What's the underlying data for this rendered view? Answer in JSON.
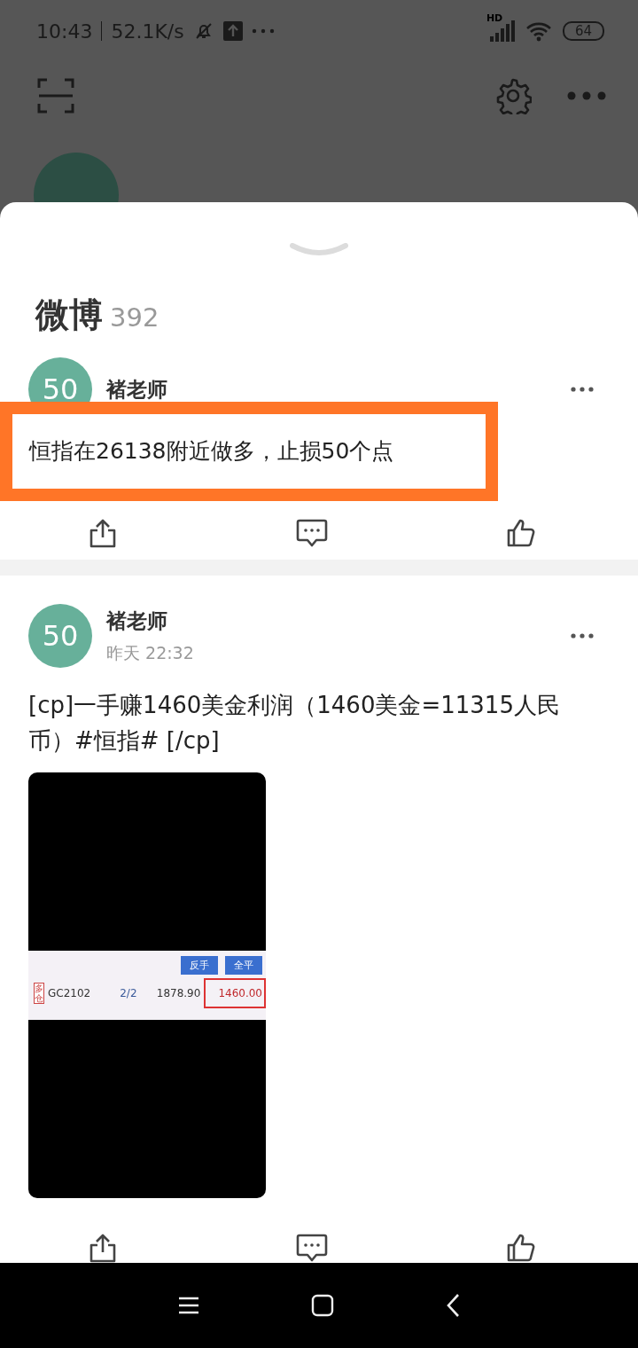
{
  "status_bar": {
    "time": "10:43",
    "speed": "52.1K/s",
    "network": "HD",
    "battery": "64"
  },
  "sheet": {
    "title": "微博",
    "count": "392"
  },
  "posts": [
    {
      "avatar": "50",
      "author": "褚老师",
      "text": "恒指在26138附近做多，止损50个点",
      "highlighted": true
    },
    {
      "avatar": "50",
      "author": "褚老师",
      "time": "昨天 22:32",
      "text": "[cp]一手赚1460美金利润（1460美金=11315人民币）#恒指# [/cp]",
      "highlighted": false,
      "image": {
        "buttons": [
          "反手",
          "全平"
        ],
        "tag": "多仓",
        "symbol": "GC2102",
        "lots": "2/2",
        "price": "1878.90",
        "profit": "1460.00"
      }
    }
  ]
}
